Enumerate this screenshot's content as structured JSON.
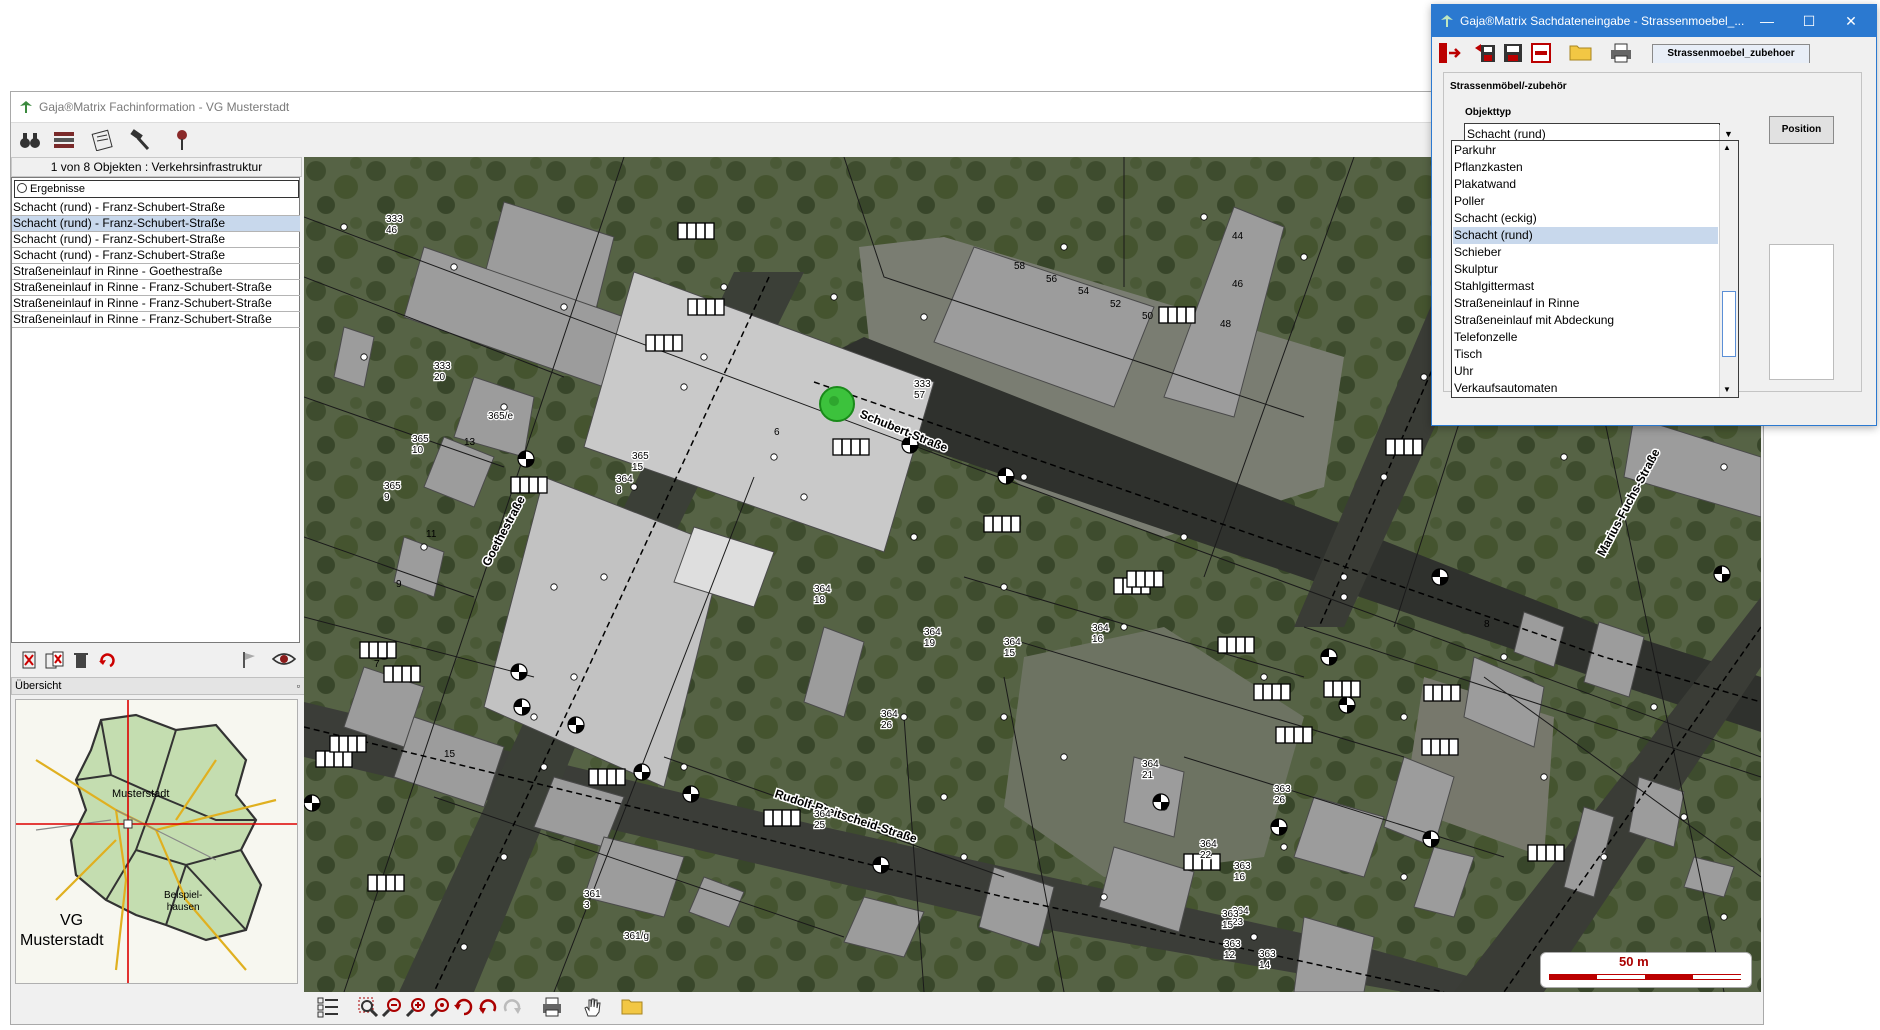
{
  "main_window": {
    "title": "Gaja®Matrix Fachinformation - VG Musterstadt",
    "toolbar_icons": [
      "binoculars-icon",
      "layers-icon",
      "notes-icon",
      "hammer-icon",
      "pushpin-icon"
    ]
  },
  "left_panel": {
    "result_count": "1 von 8 Objekten : Verkehrsinfrastruktur",
    "results_header": "Ergebnisse",
    "results": [
      "Schacht (rund) - Franz-Schubert-Straße",
      "Schacht (rund) - Franz-Schubert-Straße",
      "Schacht (rund) - Franz-Schubert-Straße",
      "Schacht (rund) - Franz-Schubert-Straße",
      "Straßeneinlauf in Rinne - Goethestraße",
      "Straßeneinlauf in Rinne - Franz-Schubert-Straße",
      "Straßeneinlauf in Rinne - Franz-Schubert-Straße",
      "Straßeneinlauf in Rinne - Franz-Schubert-Straße"
    ],
    "selected_index": 1,
    "overview_label": "Übersicht",
    "overview_map": {
      "town": "Musterstadt",
      "village": "Beispiel-\nhausen",
      "region_line1": "VG",
      "region_line2": "Musterstadt"
    }
  },
  "map": {
    "street_labels": [
      "Schubert-Straße",
      "Goethestraße",
      "Rudolf-Breitscheid-Straße",
      "Marius-Fuchs-Straße"
    ],
    "parcel_labels": [
      "333\n46",
      "333\n20",
      "365\n10",
      "365\n9",
      "365/e",
      "365\n15",
      "364\n8",
      "364\n18",
      "364\n19",
      "364\n15",
      "364\n16",
      "364\n21",
      "364\n25",
      "364\n22",
      "364\n23",
      "364\n26",
      "333\n57",
      "363\n26",
      "363\n14",
      "363\n12",
      "363\n15",
      "363\n16",
      "361\n3",
      "361/g"
    ],
    "house_numbers": [
      "58",
      "56",
      "54",
      "52",
      "50",
      "44",
      "46",
      "48",
      "6",
      "13",
      "11",
      "9",
      "7",
      "15",
      "8"
    ],
    "scale_label": "50 m"
  },
  "map_bottom_icons": [
    "legend-icon",
    "zoom-box-icon",
    "zoom-out-icon",
    "zoom-in-icon",
    "zoom-all-icon",
    "refresh-icon",
    "undo-icon",
    "redo-icon",
    "print-icon",
    "pan-hand-icon",
    "folder-icon"
  ],
  "dialog": {
    "title": "Gaja®Matrix Sachdateneingabe - Strassenmoebel_...",
    "tab_label": "Strassenmoebel_zubehoer",
    "group_label": "Strassenmöbel/-zubehör",
    "objecttype_label": "Objekttyp",
    "objecttype_value": "Schacht (rund)",
    "position_button": "Position",
    "dropdown_options": [
      "Parkuhr",
      "Pflanzkasten",
      "Plakatwand",
      "Poller",
      "Schacht (eckig)",
      "Schacht (rund)",
      "Schieber",
      "Skulptur",
      "Stahlgittermast",
      "Straßeneinlauf in Rinne",
      "Straßeneinlauf mit Abdeckung",
      "Telefonzelle",
      "Tisch",
      "Uhr",
      "Verkaufsautomaten"
    ],
    "dropdown_selected_index": 5
  }
}
